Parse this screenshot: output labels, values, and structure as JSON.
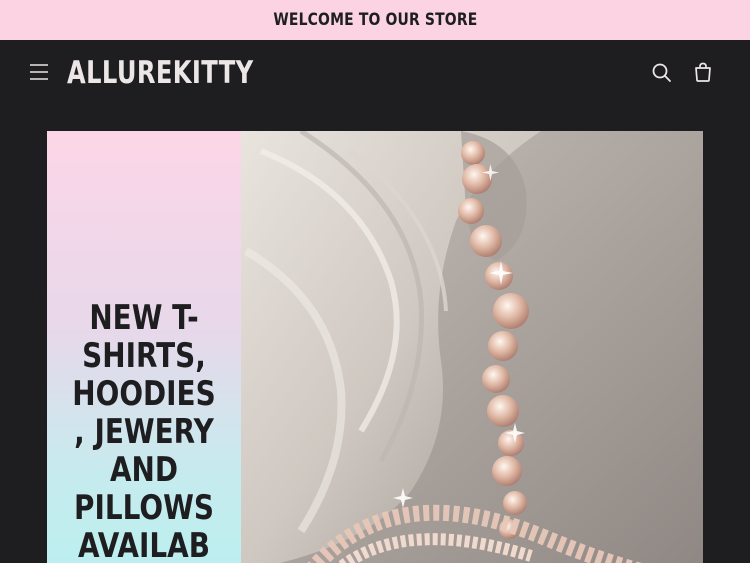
{
  "announcement": {
    "text": "WELCOME TO OUR STORE"
  },
  "header": {
    "menu_icon": "hamburger-menu-icon",
    "logo_text": "ALLUREKITTY",
    "search_icon": "search-icon",
    "cart_icon": "cart-icon"
  },
  "banner": {
    "heading_lines": [
      "NEW T-",
      "SHIRTS,",
      "HOODIES",
      ", JEWERY",
      "AND",
      "PILLOWS",
      "AVAILAB"
    ],
    "image_description_icon": "earring-photo"
  },
  "colors": {
    "announcement_bg": "#fbd3e3",
    "header_bg": "#1e1e21",
    "logo_text": "#ece6e6",
    "panel_gradient_top": "#fcd6e7",
    "panel_gradient_bottom": "#bcefef"
  }
}
